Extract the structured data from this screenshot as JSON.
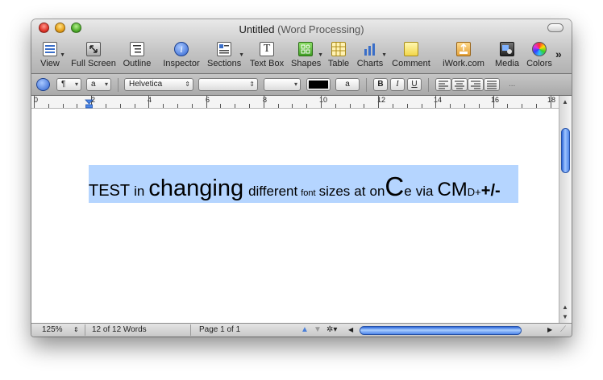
{
  "window": {
    "title": "Untitled",
    "subtitle": "(Word Processing)"
  },
  "toolbar": {
    "items": [
      {
        "label": "View",
        "icon": "view-icon",
        "dropdown": true
      },
      {
        "label": "Full Screen",
        "icon": "fullscreen-icon",
        "dropdown": false
      },
      {
        "label": "Outline",
        "icon": "outline-icon",
        "dropdown": false
      },
      {
        "label": "Inspector",
        "icon": "inspector-icon",
        "dropdown": false
      },
      {
        "label": "Sections",
        "icon": "sections-icon",
        "dropdown": true
      },
      {
        "label": "Text Box",
        "icon": "textbox-icon",
        "dropdown": false
      },
      {
        "label": "Shapes",
        "icon": "shapes-icon",
        "dropdown": true
      },
      {
        "label": "Table",
        "icon": "table-icon",
        "dropdown": false
      },
      {
        "label": "Charts",
        "icon": "charts-icon",
        "dropdown": true
      },
      {
        "label": "Comment",
        "icon": "comment-icon",
        "dropdown": false
      },
      {
        "label": "iWork.com",
        "icon": "iwork-icon",
        "dropdown": false
      },
      {
        "label": "Media",
        "icon": "media-icon",
        "dropdown": false
      },
      {
        "label": "Colors",
        "icon": "colors-icon",
        "dropdown": false
      }
    ],
    "overflow": "»"
  },
  "formatbar": {
    "paragraph_icon": "paragraph-style-icon",
    "para_symbol": "¶",
    "char_style": "a",
    "font_family": "Helvetica",
    "font_typeface": "",
    "font_size": "",
    "text_color": "#000000",
    "highlight_sample": "a",
    "bold": "B",
    "italic": "I",
    "underline": "U",
    "more": "..."
  },
  "ruler": {
    "labels": [
      "0",
      "2",
      "4",
      "6",
      "8",
      "10",
      "12",
      "14",
      "16",
      "18"
    ]
  },
  "document": {
    "words": [
      {
        "text": "TEST",
        "size": 20
      },
      {
        "text": "in",
        "size": 17
      },
      {
        "text": "changing",
        "size": 29
      },
      {
        "text": "different",
        "size": 17
      },
      {
        "text": "font",
        "size": 11
      },
      {
        "text": "sizes",
        "size": 17
      },
      {
        "text": "at",
        "size": 17
      },
      {
        "text": "on",
        "size": 17
      },
      {
        "text": "C",
        "size": 33
      },
      {
        "text": "e",
        "size": 17
      },
      {
        "text": "via",
        "size": 17
      },
      {
        "text": "CM",
        "size": 25
      },
      {
        "text": "D+",
        "size": 13
      },
      {
        "text": "+/-",
        "size": 20
      }
    ],
    "selection_color": "#b5d5ff"
  },
  "status": {
    "zoom": "125%",
    "word_count": "12 of 12 Words",
    "page": "Page 1 of 1"
  }
}
